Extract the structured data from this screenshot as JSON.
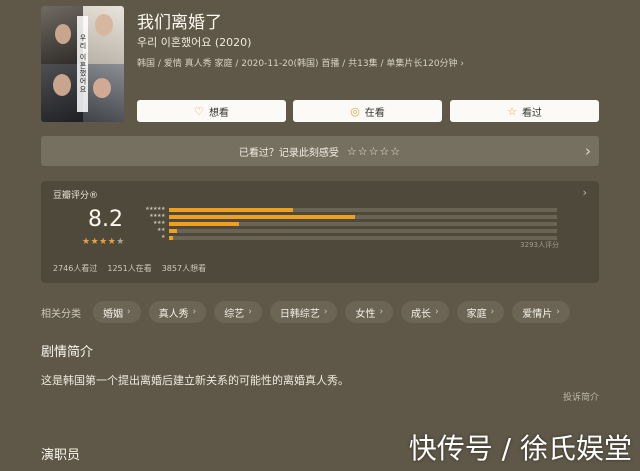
{
  "header": {
    "title": "我们离婚了",
    "original_title": "우리 이혼했어요 (2020)",
    "meta": "韩国 / 爱情 真人秀 家庭 / 2020-11-20(韩国) 首播 / 共13集 / 单集片长120分钟 ›"
  },
  "poster": {
    "vertical_text": "우리 이혼했어요"
  },
  "actions": [
    {
      "label": "想看",
      "icon": "heart-plus-icon",
      "glyph": "♡"
    },
    {
      "label": "在看",
      "icon": "target-icon",
      "glyph": "◎"
    },
    {
      "label": "看过",
      "icon": "star-icon",
      "glyph": "☆"
    }
  ],
  "rate_prompt": {
    "text": "已看过？记录此刻感受",
    "stars": "☆☆☆☆☆"
  },
  "score": {
    "label": "豆瓣评分®",
    "value": "8.2",
    "stars_on": "★★★★",
    "stars_off": "★",
    "distribution": [
      {
        "stars": "★★★★★",
        "percent": 32
      },
      {
        "stars": "★★★★",
        "percent": 48
      },
      {
        "stars": "★★★",
        "percent": 18
      },
      {
        "stars": "★★",
        "percent": 2
      },
      {
        "stars": "★",
        "percent": 1
      }
    ],
    "count": "3293人评分",
    "watched": "2746人看过",
    "watching": "1251人在看",
    "wish": "3857人想看"
  },
  "categories": {
    "head": "相关分类",
    "tags": [
      "婚姻",
      "真人秀",
      "综艺",
      "日韩综艺",
      "女性",
      "成长",
      "家庭",
      "爱情片"
    ]
  },
  "synopsis": {
    "title": "剧情简介",
    "text": "这是韩国第一个提出离婚后建立新关系的可能性的离婚真人秀。",
    "report": "投诉简介"
  },
  "cast": {
    "title": "演职员"
  },
  "watermark": "快传号 / 徐氏娱堂",
  "colors": {
    "accent": "#f0a020",
    "background": "#5f5848"
  }
}
